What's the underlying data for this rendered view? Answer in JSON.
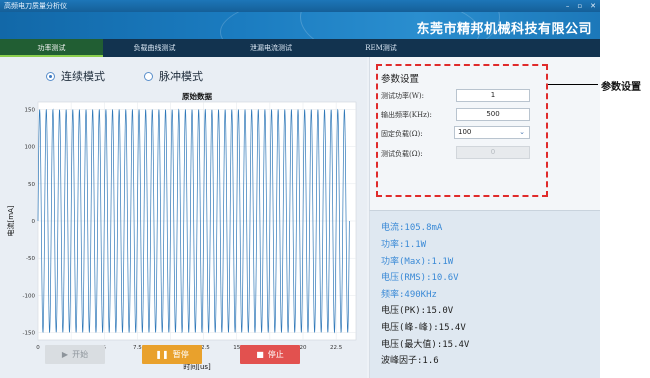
{
  "window": {
    "title": "高频电刀质量分析仪",
    "controls": [
      "–",
      "▫",
      "✕"
    ]
  },
  "banner": {
    "company": "东莞市精邦机械科技有限公司"
  },
  "tabs": [
    {
      "label": "功率测试",
      "active": true
    },
    {
      "label": "负载曲线测试",
      "active": false
    },
    {
      "label": "泄漏电流测试",
      "active": false
    },
    {
      "label": "REM测试",
      "active": false
    }
  ],
  "modes": {
    "continuous": "连续模式",
    "pulse": "脉冲模式",
    "selected": "continuous"
  },
  "buttons": {
    "start": "开始",
    "pause": "暂停",
    "stop": "停止"
  },
  "settings": {
    "title": "参数设置",
    "power_label": "测试功率(W):",
    "power_value": "1",
    "freq_label": "输出频率(KHz):",
    "freq_value": "500",
    "load_label": "固定负载(Ω):",
    "load_value": "100",
    "test_load_label": "测试负载(Ω):",
    "test_load_value": "0"
  },
  "annotation": {
    "label": "参数设置"
  },
  "readings": [
    {
      "text": "电流:105.8mA",
      "color": "blue"
    },
    {
      "text": "功率:1.1W",
      "color": "blue"
    },
    {
      "text": "功率(Max):1.1W",
      "color": "blue"
    },
    {
      "text": "电压(RMS):10.6V",
      "color": "blue"
    },
    {
      "text": "频率:490KHz",
      "color": "blue"
    },
    {
      "text": "电压(PK):15.0V",
      "color": "black"
    },
    {
      "text": "电压(峰-峰):15.4V",
      "color": "black"
    },
    {
      "text": "电压(最大值):15.4V",
      "color": "black"
    },
    {
      "text": "波峰因子:1.6",
      "color": "black"
    }
  ],
  "chart_data": {
    "type": "line",
    "title": "原始数据",
    "xlabel": "时间[us]",
    "ylabel": "电流[mA]",
    "xlim": [
      0,
      24
    ],
    "ylim": [
      -160,
      160
    ],
    "xticks": [
      0,
      2.5,
      5,
      7.5,
      10,
      12.5,
      15,
      17.5,
      20,
      22.5
    ],
    "yticks": [
      -150,
      -100,
      -50,
      0,
      50,
      100,
      150
    ],
    "series": [
      {
        "color": "#2f78b8",
        "frequency_mhz": 2.0,
        "amplitude": 150,
        "x_start": 0,
        "x_end": 23.5
      }
    ]
  }
}
